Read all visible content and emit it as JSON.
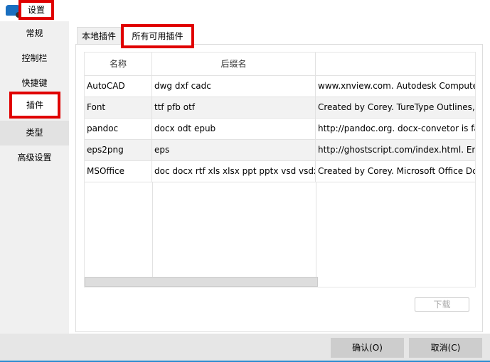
{
  "window": {
    "title": "设置",
    "icon": "app-logo-icon"
  },
  "sidebar": {
    "items": [
      {
        "label": "常规"
      },
      {
        "label": "控制栏"
      },
      {
        "label": "快捷键"
      },
      {
        "label": "插件"
      },
      {
        "label": "类型"
      },
      {
        "label": "高级设置"
      }
    ]
  },
  "tabs": [
    {
      "label": "本地插件"
    },
    {
      "label": "所有可用插件"
    }
  ],
  "table": {
    "headers": [
      "名称",
      "后缀名",
      ""
    ],
    "rows": [
      [
        "AutoCAD",
        "dwg dxf cadc",
        "www.xnview.com. Autodesk Computer"
      ],
      [
        "Font",
        "ttf pfb otf",
        "Created by Corey. TureType Outlines,"
      ],
      [
        "pandoc",
        "docx odt epub",
        "http://pandoc.org. docx-convetor is fa"
      ],
      [
        "eps2png",
        "eps",
        "http://ghostscript.com/index.html. Enc"
      ],
      [
        "MSOffice",
        "doc docx rtf xls xlsx ppt pptx vsd vsdx",
        "Created by Corey. Microsoft Office Dc"
      ]
    ]
  },
  "download_label": "下载",
  "footer": {
    "ok": "确认(O)",
    "cancel": "取消(C)"
  },
  "colors": {
    "highlight": "#e00000",
    "accent": "#2a8ad0"
  }
}
